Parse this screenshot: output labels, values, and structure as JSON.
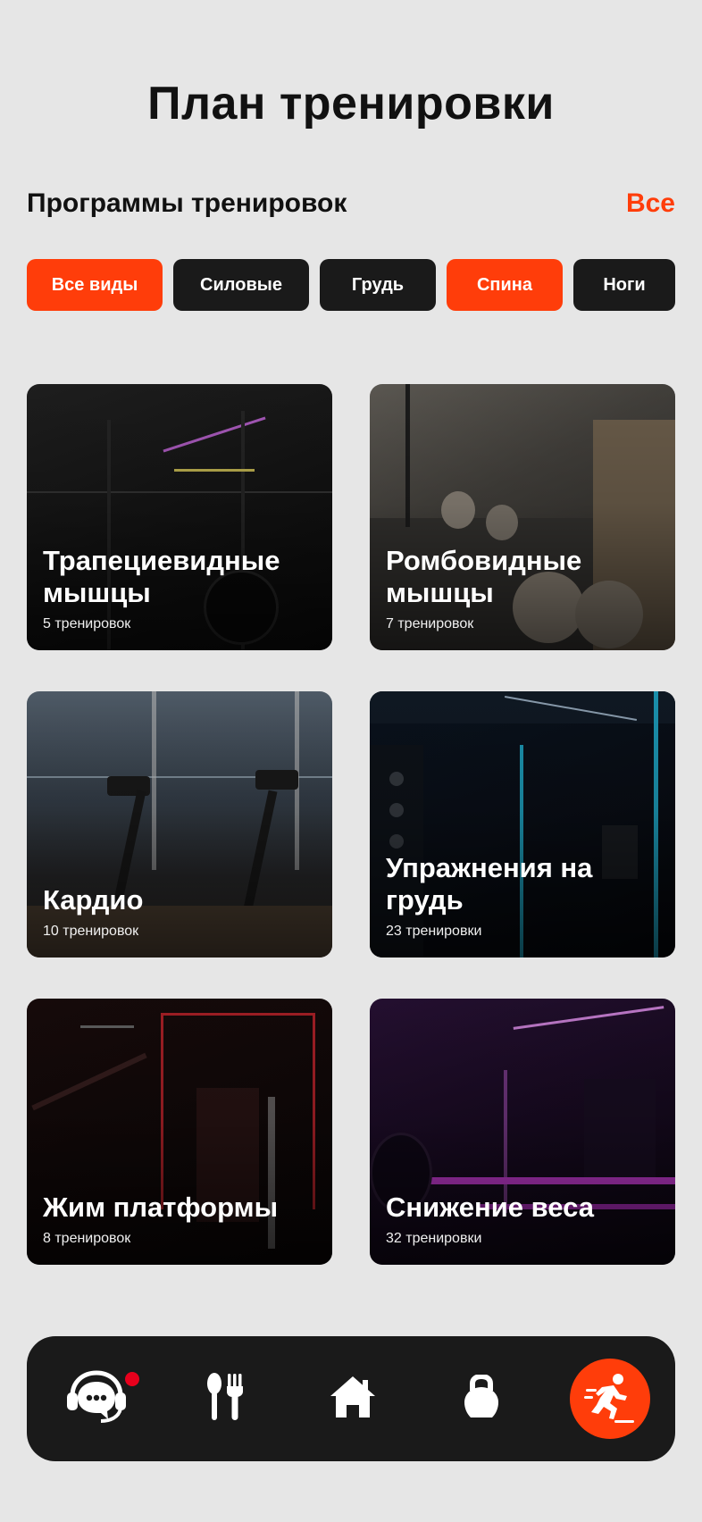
{
  "header": {
    "title": "План тренировки"
  },
  "section": {
    "title": "Программы тренировок",
    "see_all": "Все"
  },
  "filters": [
    {
      "label": "Все виды",
      "active": true
    },
    {
      "label": "Силовые",
      "active": false
    },
    {
      "label": "Грудь",
      "active": false
    },
    {
      "label": "Спина",
      "active": true
    },
    {
      "label": "Ноги",
      "active": false
    }
  ],
  "programs": [
    {
      "title": "Трапециевидные мышцы",
      "count": "5 тренировок"
    },
    {
      "title": "Ромбовидные мышцы",
      "count": "7 тренировок"
    },
    {
      "title": "Кардио",
      "count": "10 тренировок"
    },
    {
      "title": "Упражнения на грудь",
      "count": "23 тренировки"
    },
    {
      "title": "Жим платформы",
      "count": "8 тренировок"
    },
    {
      "title": "Снижение веса",
      "count": "32 тренировки"
    }
  ],
  "nav": {
    "items": [
      {
        "icon": "chat-support-icon",
        "has_badge": true,
        "active": false
      },
      {
        "icon": "fork-spoon-icon",
        "active": false
      },
      {
        "icon": "home-icon",
        "active": false
      },
      {
        "icon": "kettlebell-icon",
        "active": false
      },
      {
        "icon": "running-person-icon",
        "active": true
      }
    ]
  },
  "colors": {
    "accent": "#ff3d0a",
    "dark": "#1a1a1a",
    "background": "#e6e6e6",
    "badge": "#e8001c"
  }
}
